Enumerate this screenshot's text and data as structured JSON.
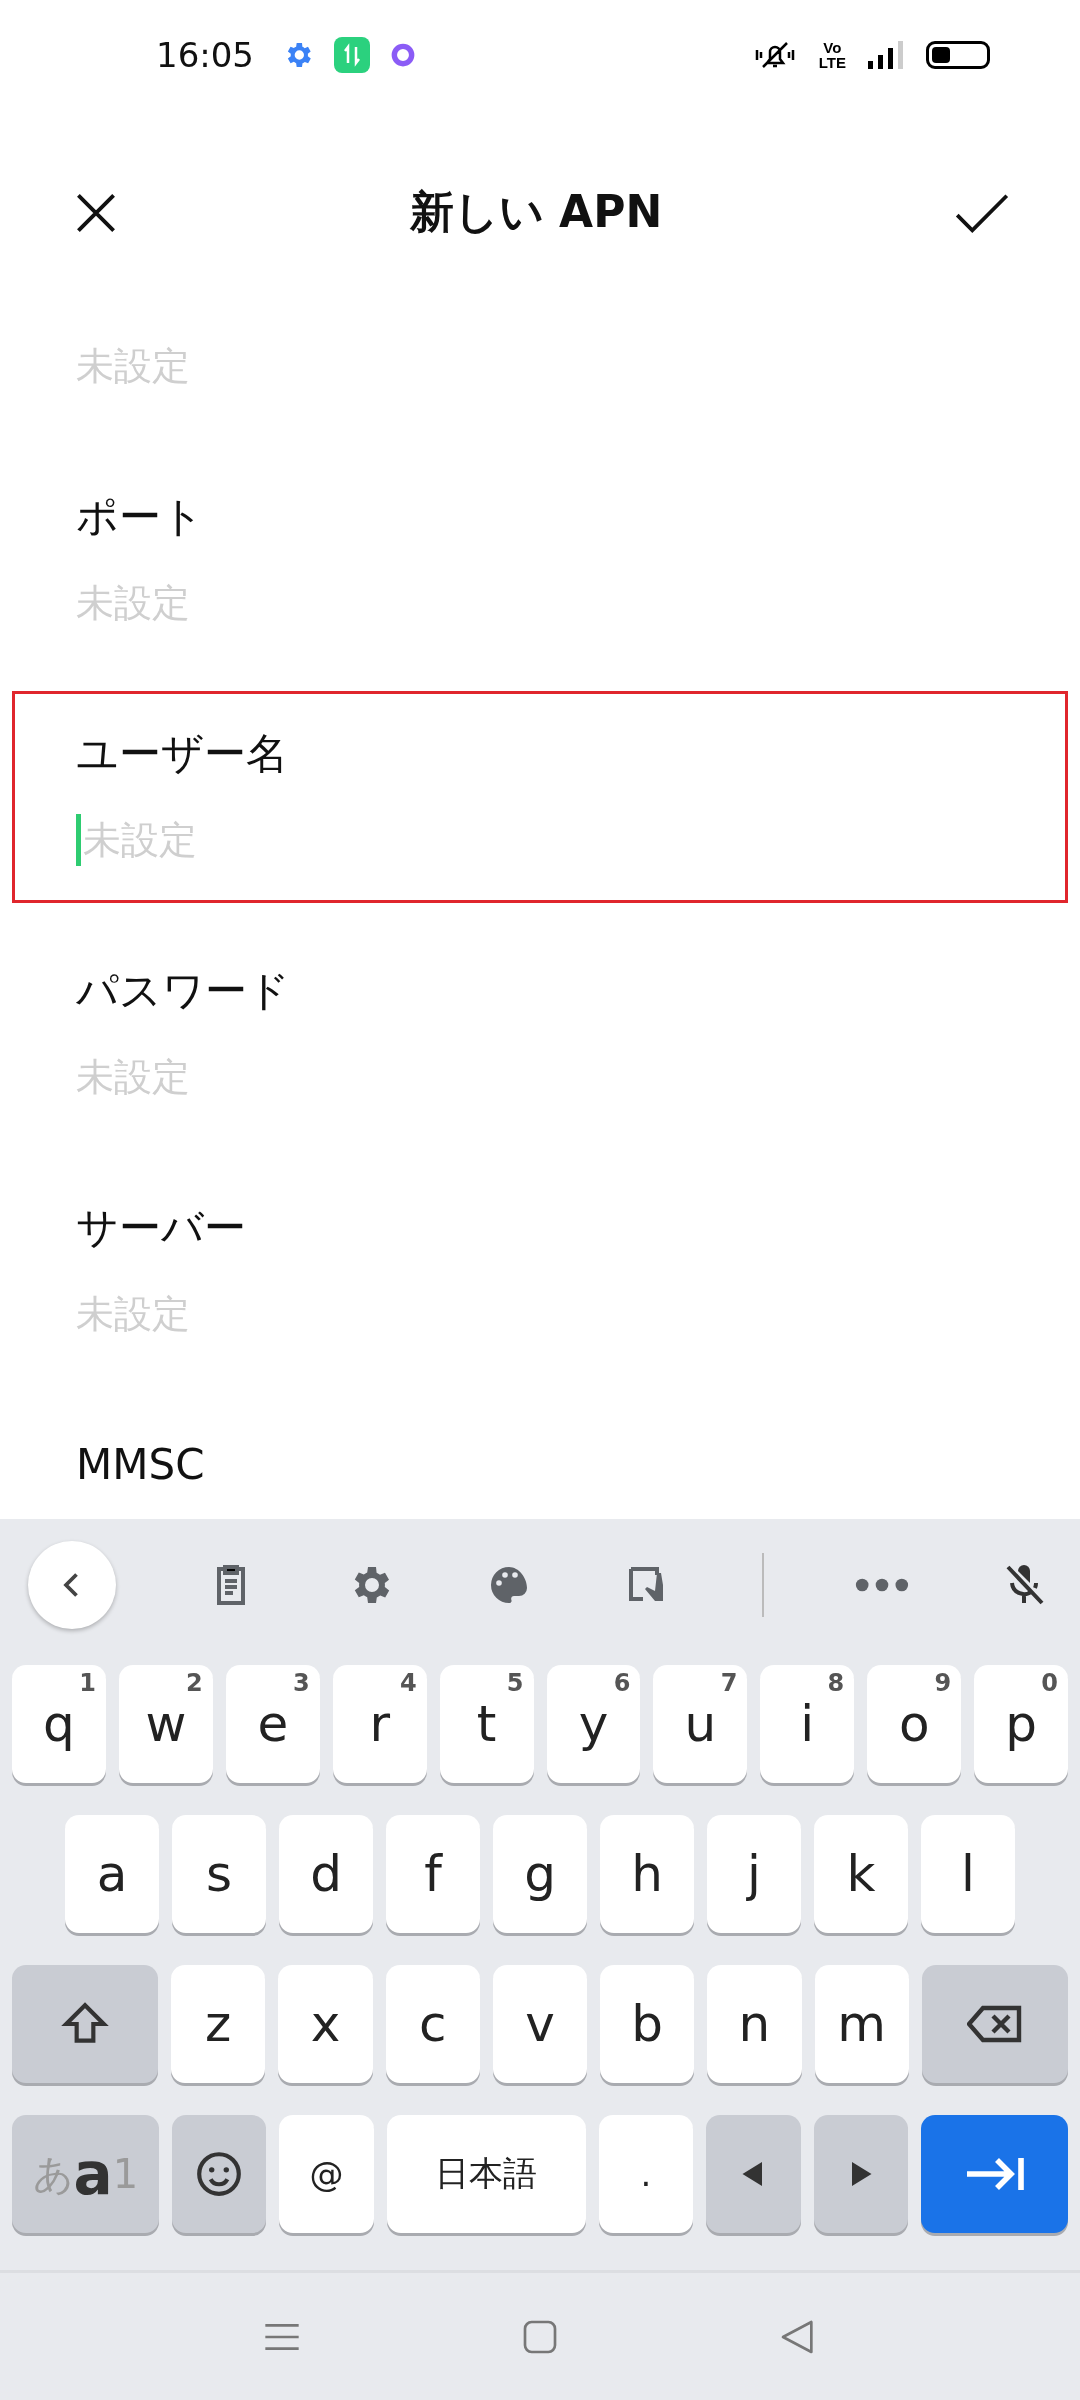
{
  "status_bar": {
    "time": "16:05",
    "network_label": "Vo\nLTE"
  },
  "header": {
    "title": "新しい APN"
  },
  "fields": [
    {
      "placeholder": "未設定",
      "selected": false
    },
    {
      "label": "ポート",
      "placeholder": "未設定",
      "selected": false
    },
    {
      "label": "ユーザー名",
      "placeholder": "未設定",
      "selected": true
    },
    {
      "label": "パスワード",
      "placeholder": "未設定",
      "selected": false
    },
    {
      "label": "サーバー",
      "placeholder": "未設定",
      "selected": false
    },
    {
      "label": "MMSC",
      "selected": false
    }
  ],
  "keyboard": {
    "rows": [
      {
        "keys": [
          {
            "kind": "letter",
            "label": "q",
            "hint": "1"
          },
          {
            "kind": "letter",
            "label": "w",
            "hint": "2"
          },
          {
            "kind": "letter",
            "label": "e",
            "hint": "3"
          },
          {
            "kind": "letter",
            "label": "r",
            "hint": "4"
          },
          {
            "kind": "letter",
            "label": "t",
            "hint": "5"
          },
          {
            "kind": "letter",
            "label": "y",
            "hint": "6"
          },
          {
            "kind": "letter",
            "label": "u",
            "hint": "7"
          },
          {
            "kind": "letter",
            "label": "i",
            "hint": "8"
          },
          {
            "kind": "letter",
            "label": "o",
            "hint": "9"
          },
          {
            "kind": "letter",
            "label": "p",
            "hint": "0"
          }
        ]
      },
      {
        "keys": [
          {
            "kind": "letter",
            "label": "a"
          },
          {
            "kind": "letter",
            "label": "s"
          },
          {
            "kind": "letter",
            "label": "d"
          },
          {
            "kind": "letter",
            "label": "f"
          },
          {
            "kind": "letter",
            "label": "g"
          },
          {
            "kind": "letter",
            "label": "h"
          },
          {
            "kind": "letter",
            "label": "j"
          },
          {
            "kind": "letter",
            "label": "k"
          },
          {
            "kind": "letter",
            "label": "l"
          }
        ]
      },
      {
        "keys": [
          {
            "kind": "shift"
          },
          {
            "kind": "letter",
            "label": "z"
          },
          {
            "kind": "letter",
            "label": "x"
          },
          {
            "kind": "letter",
            "label": "c"
          },
          {
            "kind": "letter",
            "label": "v"
          },
          {
            "kind": "letter",
            "label": "b"
          },
          {
            "kind": "letter",
            "label": "n"
          },
          {
            "kind": "letter",
            "label": "m"
          },
          {
            "kind": "backspace"
          }
        ]
      },
      {
        "keys": [
          {
            "kind": "mode",
            "parts": [
              "あ",
              "a",
              "1"
            ]
          },
          {
            "kind": "emoji"
          },
          {
            "kind": "char",
            "label": "@"
          },
          {
            "kind": "space",
            "label": "日本語"
          },
          {
            "kind": "char",
            "label": "."
          },
          {
            "kind": "left"
          },
          {
            "kind": "right"
          },
          {
            "kind": "enter"
          }
        ]
      }
    ]
  }
}
